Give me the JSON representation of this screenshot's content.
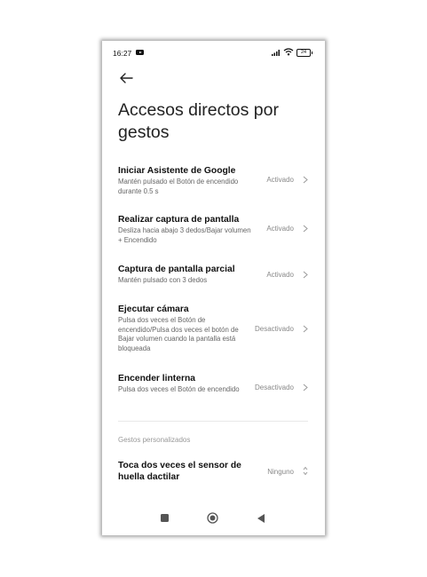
{
  "status": {
    "time": "16:27",
    "battery": "24"
  },
  "page": {
    "title": "Accesos directos por gestos"
  },
  "items": [
    {
      "title": "Iniciar Asistente de Google",
      "subtitle": "Mantén pulsado el Botón de encendido durante 0.5 s",
      "value": "Activado"
    },
    {
      "title": "Realizar captura de pantalla",
      "subtitle": "Desliza hacia abajo 3 dedos/Bajar volumen + Encendido",
      "value": "Activado"
    },
    {
      "title": "Captura de pantalla parcial",
      "subtitle": "Mantén pulsado con 3 dedos",
      "value": "Activado"
    },
    {
      "title": "Ejecutar cámara",
      "subtitle": "Pulsa dos veces el Botón de encendido/Pulsa dos veces el botón de Bajar volumen cuando la pantalla está bloqueada",
      "value": "Desactivado"
    },
    {
      "title": "Encender linterna",
      "subtitle": "Pulsa dos veces el Botón de encendido",
      "value": "Desactivado"
    }
  ],
  "custom": {
    "section_label": "Gestos personalizados",
    "item": {
      "title": "Toca dos veces el sensor de huella dactilar",
      "value": "Ninguno"
    }
  },
  "colors": {
    "text": "#111111",
    "secondary": "#666666",
    "value": "#888888"
  }
}
